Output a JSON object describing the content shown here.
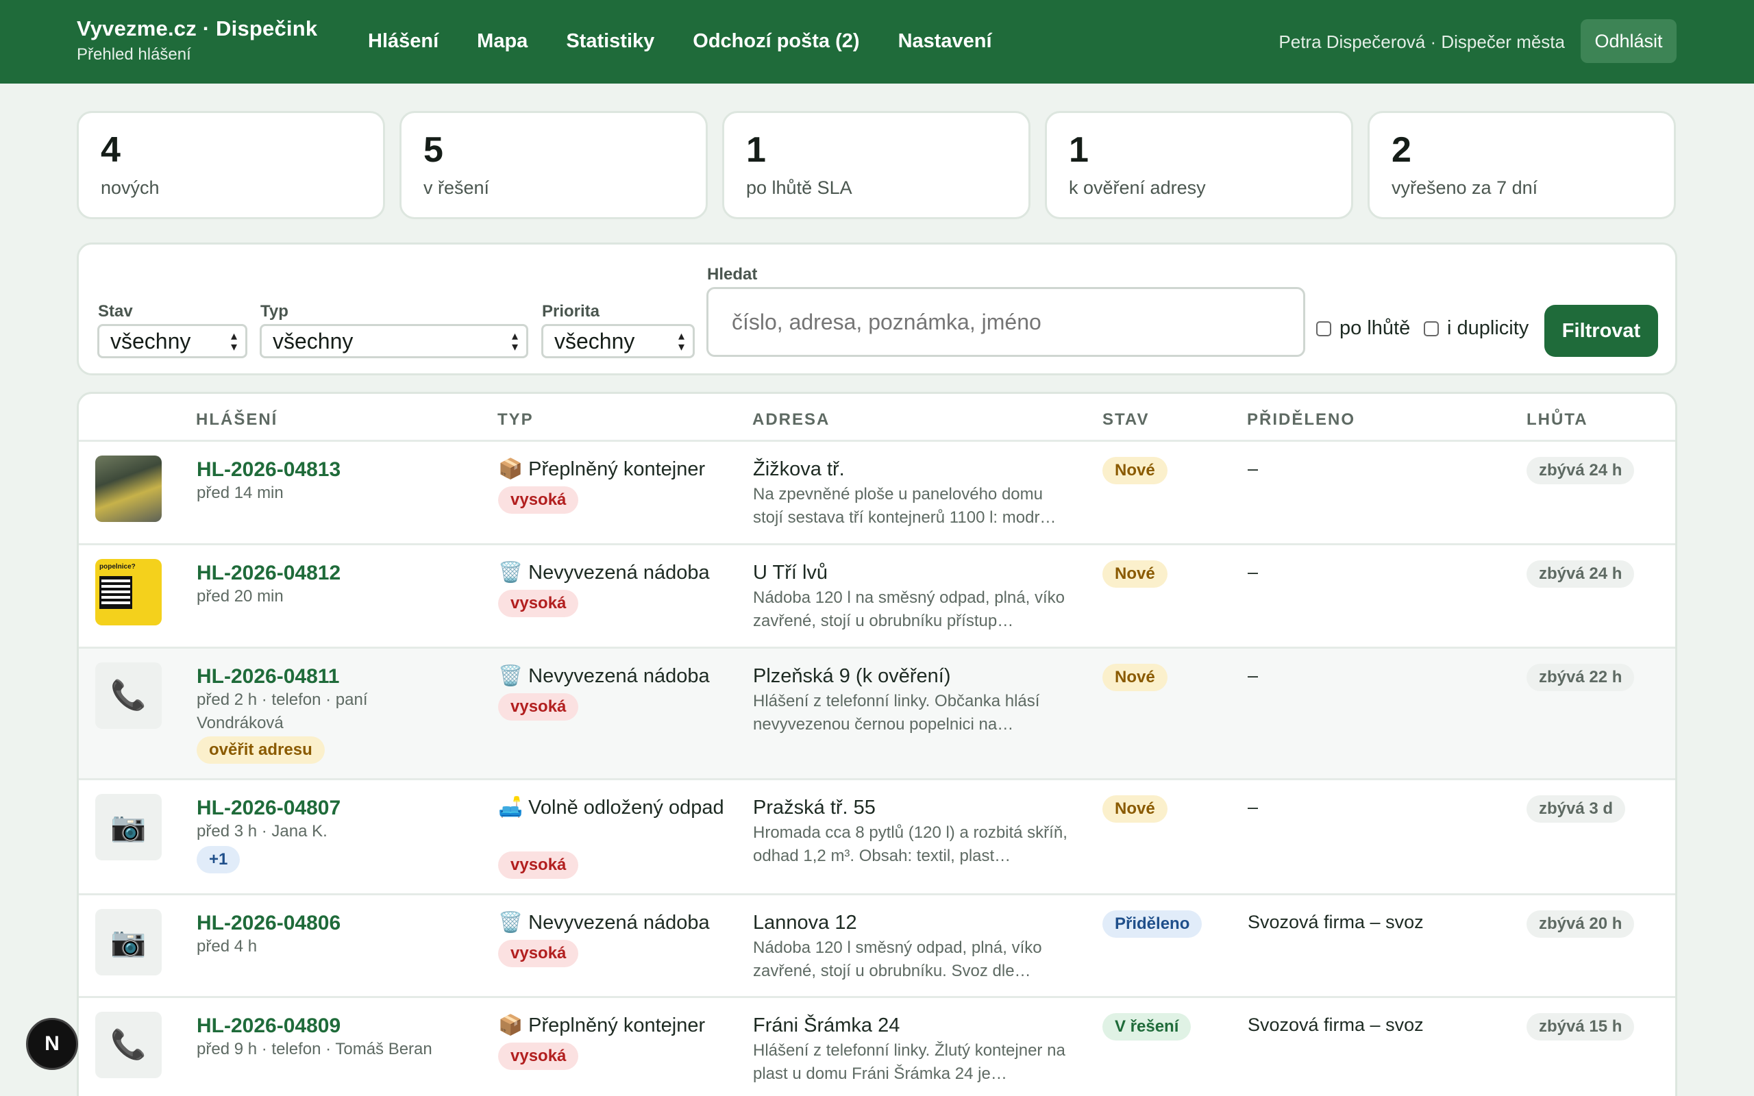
{
  "header": {
    "title": "Vyvezme.cz · Dispečink",
    "subtitle": "Přehled hlášení",
    "nav": [
      "Hlášení",
      "Mapa",
      "Statistiky",
      "Odchozí pošta (2)",
      "Nastavení"
    ],
    "user": "Petra Dispečerová · Dispečer města",
    "logout": "Odhlásit"
  },
  "stats": [
    {
      "value": "4",
      "label": "nových"
    },
    {
      "value": "5",
      "label": "v řešení"
    },
    {
      "value": "1",
      "label": "po lhůtě SLA"
    },
    {
      "value": "1",
      "label": "k ověření adresy"
    },
    {
      "value": "2",
      "label": "vyřešeno za 7 dní"
    }
  ],
  "filters": {
    "status_label": "Stav",
    "status_value": "všechny",
    "type_label": "Typ",
    "type_value": "všechny",
    "priority_label": "Priorita",
    "priority_value": "všechny",
    "search_label": "Hledat",
    "search_placeholder": "číslo, adresa, poznámka, jméno",
    "overdue_label": "po lhůtě",
    "duplicates_label": "i duplicity",
    "button": "Filtrovat"
  },
  "table": {
    "headers": [
      "HLÁŠENÍ",
      "TYP",
      "ADRESA",
      "STAV",
      "PŘIDĚLENO",
      "LHŮTA"
    ],
    "rows": [
      {
        "code": "HL-2026-04813",
        "meta": "před 14 min",
        "type_icon": "📦",
        "type": "Přeplněný kontejner",
        "priority": "vysoká",
        "address": "Žižkova tř.",
        "note": "Na zpevněné ploše u panelového domu stojí sestava tří kontejnerů 1100 l: modr…",
        "status": "Nové",
        "assigned": "–",
        "sla": "zbývá 24 h"
      },
      {
        "code": "HL-2026-04812",
        "meta": "před 20 min",
        "type_icon": "🗑️",
        "type": "Nevyvezená nádoba",
        "priority": "vysoká",
        "address": "U Tří lvů",
        "note": "Nádoba 120 l na směsný odpad, plná, víko zavřené, stojí u obrubníku přístup…",
        "status": "Nové",
        "assigned": "–",
        "sla": "zbývá 24 h",
        "poster_text": "popelnice?"
      },
      {
        "code": "HL-2026-04811",
        "meta": "před 2 h · telefon · paní Vondráková",
        "extra": "ověřit adresu",
        "type_icon": "🗑️",
        "type": "Nevyvezená nádoba",
        "priority": "vysoká",
        "address": "Plzeňská 9 (k ověření)",
        "note": "Hlášení z telefonní linky. Občanka hlásí nevyvezenou černou popelnici na…",
        "status": "Nové",
        "assigned": "–",
        "sla": "zbývá 22 h"
      },
      {
        "code": "HL-2026-04807",
        "meta": "před 3 h · Jana K.",
        "extra": "+1",
        "type_icon": "🛋️",
        "type": "Volně odložený odpad",
        "priority": "vysoká",
        "address": "Pražská tř. 55",
        "note": "Hromada cca 8 pytlů (120 l) a rozbitá skříň, odhad 1,2 m³. Obsah: textil, plast…",
        "status": "Nové",
        "assigned": "–",
        "sla": "zbývá 3 d"
      },
      {
        "code": "HL-2026-04806",
        "meta": "před 4 h",
        "type_icon": "🗑️",
        "type": "Nevyvezená nádoba",
        "priority": "vysoká",
        "address": "Lannova 12",
        "note": "Nádoba 120 l směsný odpad, plná, víko zavřené, stojí u obrubníku. Svoz dle…",
        "status": "Přiděleno",
        "assigned": "Svozová firma – svoz",
        "sla": "zbývá 20 h"
      },
      {
        "code": "HL-2026-04809",
        "meta": "před 9 h · telefon · Tomáš Beran",
        "type_icon": "📦",
        "type": "Přeplněný kontejner",
        "priority": "vysoká",
        "address": "Fráni Šrámka 24",
        "note": "Hlášení z telefonní linky. Žlutý kontejner na plast u domu Fráni Šrámka 24 je…",
        "status": "V řešení",
        "assigned": "Svozová firma – svoz",
        "sla": "zbývá 15 h"
      }
    ]
  },
  "fab": "N",
  "colors": {
    "brand": "#1f6b3a",
    "background": "#eef3ef"
  }
}
